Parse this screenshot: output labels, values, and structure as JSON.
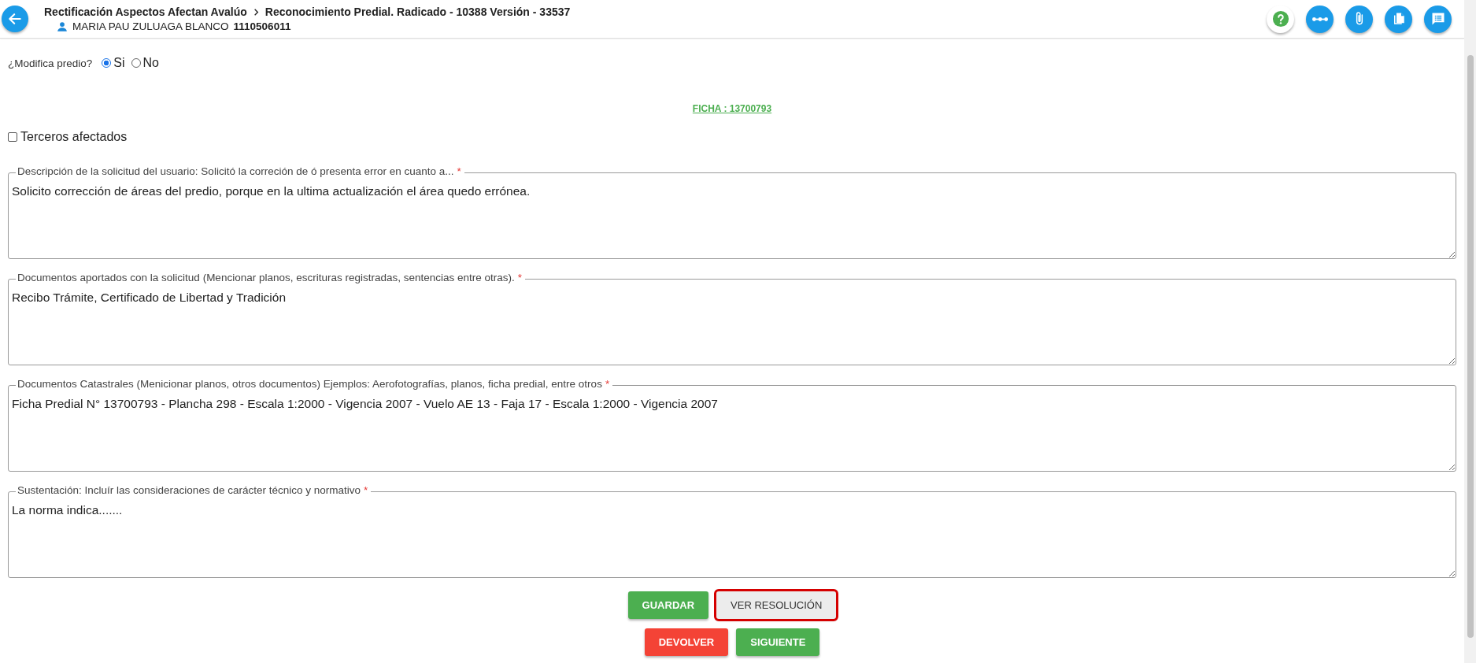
{
  "header": {
    "breadcrumb": [
      {
        "label": "Rectificación Aspectos Afectan Avalúo"
      },
      {
        "label": "Reconocimiento Predial. Radicado - 10388 Versión - 33537"
      }
    ],
    "user": {
      "name": "MARIA PAU ZULUAGA BLANCO",
      "id": "1110506011"
    },
    "actions": [
      {
        "kind": "help"
      },
      {
        "kind": "flow"
      },
      {
        "kind": "attach"
      },
      {
        "kind": "copy"
      },
      {
        "kind": "notes"
      }
    ]
  },
  "modifica": {
    "label": "¿Modifica predio?",
    "options": [
      {
        "label": "Si",
        "selected": true
      },
      {
        "label": "No",
        "selected": false
      }
    ]
  },
  "ficha_link": "FICHA : 13700793",
  "terceros": {
    "label": "Terceros afectados",
    "checked": false
  },
  "fields": [
    {
      "label": "Descripción de la solicitud del usuario: Solicitó la correción de ó presenta error en cuanto a...",
      "required_mark": "*",
      "value": "Solicito corrección de áreas del predio, porque en la ultima actualización el área quedo errónea."
    },
    {
      "label": "Documentos aportados con la solicitud (Mencionar planos, escrituras registradas, sentencias entre otras).",
      "required_mark": "*",
      "value": "Recibo Trámite, Certificado de Libertad y Tradición"
    },
    {
      "label": "Documentos Catastrales (Menicionar planos, otros documentos) Ejemplos: Aerofotografías, planos, ficha predial, entre otros",
      "required_mark": "*",
      "value": "Ficha Predial N° 13700793 - Plancha 298 - Escala 1:2000 - Vigencia 2007 - Vuelo AE 13 - Faja 17 - Escala 1:2000 - Vigencia 2007"
    },
    {
      "label": "Sustentación: Incluír las consideraciones de carácter técnico y normativo",
      "required_mark": "*",
      "value": "La norma indica......."
    }
  ],
  "button_rows": [
    [
      {
        "label": "GUARDAR",
        "kind": "success",
        "focused": false
      },
      {
        "label": "VER RESOLUCIÓN",
        "kind": "plain",
        "focused": true
      }
    ],
    [
      {
        "label": "DEVOLVER",
        "kind": "danger",
        "focused": false
      },
      {
        "label": "SIGUIENTE",
        "kind": "success",
        "focused": false
      }
    ]
  ]
}
